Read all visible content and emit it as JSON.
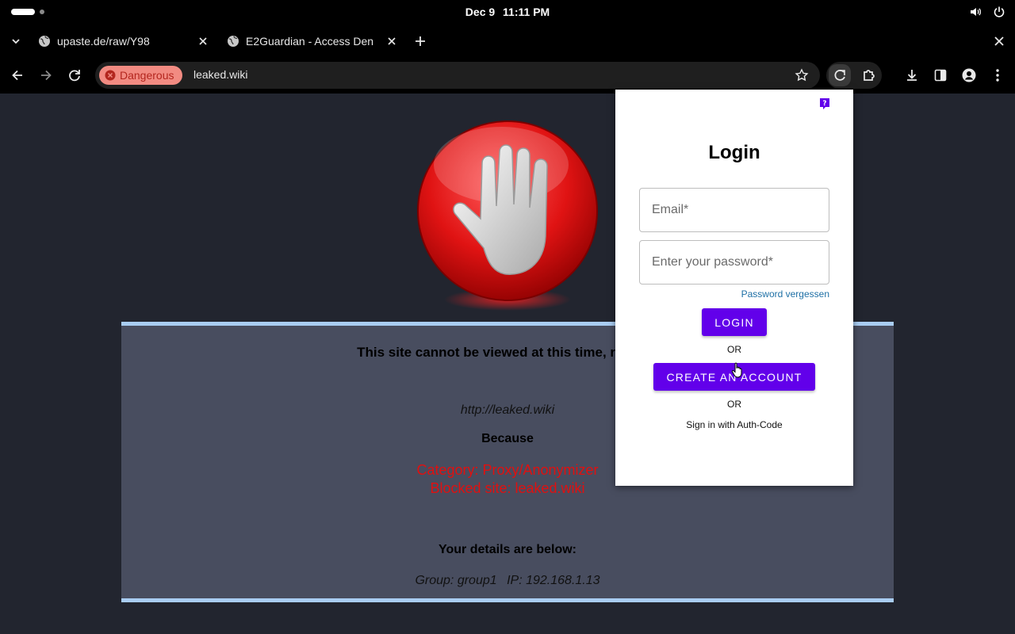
{
  "system": {
    "date": "Dec 9",
    "time": "11:11 PM"
  },
  "tabs": [
    {
      "title": "upaste.de/raw/Y98"
    },
    {
      "title": "E2Guardian - Access Den"
    }
  ],
  "address_bar": {
    "security_chip": "Dangerous",
    "url": "leaked.wiki"
  },
  "block_page": {
    "heading": "This site cannot be viewed at this time, read be",
    "blocked_url": "http://leaked.wiki",
    "because_label": "Because",
    "category": "Category: Proxy/Anonymizer",
    "blocked_site": "Blocked site: leaked.wiki",
    "details_label": "Your details are below:",
    "group": "Group: group1",
    "ip": "IP: 192.168.1.13"
  },
  "login_popup": {
    "title": "Login",
    "email_placeholder": "Email*",
    "password_placeholder": "Enter your password*",
    "forgot_link": "Password vergessen",
    "login_button": "LOGIN",
    "or_1": "OR",
    "create_account_button": "CREATE AN ACCOUNT",
    "or_2": "OR",
    "auth_code_link": "Sign in with Auth-Code"
  },
  "colors": {
    "accent": "#6200ea",
    "danger_chip_bg": "#f28b82",
    "block_reason": "#e01010",
    "panel_bg": "#484d5f",
    "panel_border": "#a9cdf2",
    "page_bg": "#22252f"
  },
  "icons": [
    "activities-icon",
    "volume-icon",
    "power-icon",
    "tab-list-icon",
    "globe-icon",
    "close-icon",
    "plus-icon",
    "back-icon",
    "forward-icon",
    "reload-icon",
    "danger-icon",
    "star-icon",
    "extension-icon",
    "puzzle-icon",
    "download-icon",
    "side-panel-icon",
    "profile-icon",
    "menu-icon",
    "help-icon",
    "stop-hand-icon"
  ]
}
